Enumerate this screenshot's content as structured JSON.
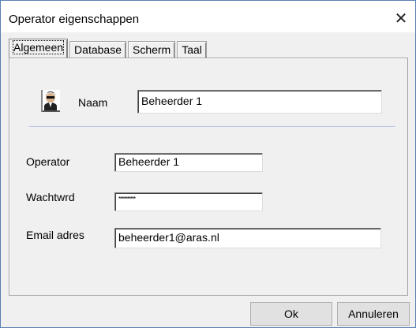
{
  "window": {
    "title": "Operator eigenschappen",
    "close_glyph": "✕"
  },
  "tabs": [
    {
      "label": "Algemeen",
      "active": true
    },
    {
      "label": "Database",
      "active": false
    },
    {
      "label": "Scherm",
      "active": false
    },
    {
      "label": "Taal",
      "active": false
    }
  ],
  "form": {
    "naam_label": "Naam",
    "naam_value": "Beheerder 1",
    "operator_label": "Operator",
    "operator_value": "Beheerder 1",
    "wachtwoord_label": "Wachtwrd",
    "wachtwoord_value": "**********",
    "email_label": "Email adres",
    "email_value": "beheerder1@aras.nl"
  },
  "buttons": {
    "ok": "Ok",
    "cancel": "Annuleren"
  },
  "icons": {
    "avatar": "user-avatar-icon",
    "close": "close-icon"
  }
}
